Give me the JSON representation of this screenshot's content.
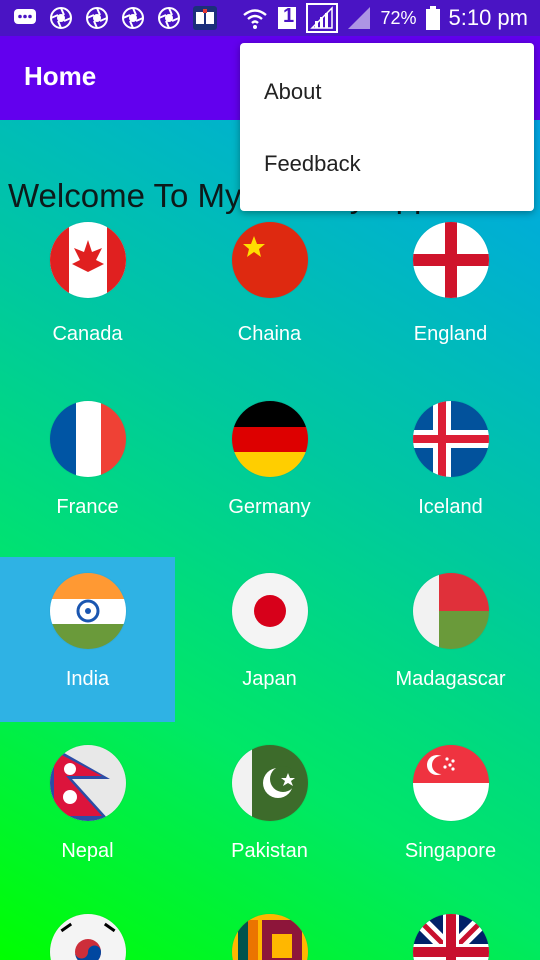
{
  "status_bar": {
    "battery_percent": "72%",
    "time": "5:10 pm",
    "sim_label": "1",
    "icons": [
      "messages-icon",
      "shutter-icon",
      "shutter-icon",
      "shutter-icon",
      "shutter-icon",
      "book-app-icon",
      "wifi-icon",
      "sim-icon",
      "signal-icon",
      "signal-icon",
      "battery-icon"
    ]
  },
  "app_bar": {
    "title": "Home"
  },
  "content": {
    "welcome_text": "Welcome To My Country App"
  },
  "menu": {
    "items": [
      {
        "label": "About"
      },
      {
        "label": "Feedback"
      }
    ]
  },
  "countries": [
    {
      "name": "Canada"
    },
    {
      "name": "Chaina"
    },
    {
      "name": "England"
    },
    {
      "name": "France"
    },
    {
      "name": "Germany"
    },
    {
      "name": "Iceland"
    },
    {
      "name": "India",
      "selected": true
    },
    {
      "name": "Japan"
    },
    {
      "name": "Madagascar"
    },
    {
      "name": "Nepal"
    },
    {
      "name": "Pakistan"
    },
    {
      "name": "Singapore"
    },
    {
      "name": ""
    },
    {
      "name": ""
    },
    {
      "name": ""
    }
  ],
  "colors": {
    "status_bar": "#4a14c4",
    "app_bar": "#6200ee",
    "selected_cell": "#2fb2e4"
  }
}
